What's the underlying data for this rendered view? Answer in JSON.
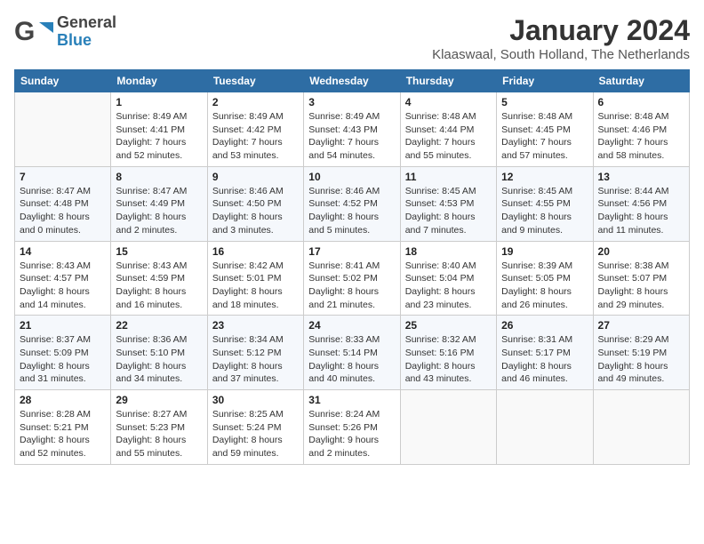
{
  "logo": {
    "text_general": "General",
    "text_blue": "Blue"
  },
  "header": {
    "month_title": "January 2024",
    "subtitle": "Klaaswaal, South Holland, The Netherlands"
  },
  "weekdays": [
    "Sunday",
    "Monday",
    "Tuesday",
    "Wednesday",
    "Thursday",
    "Friday",
    "Saturday"
  ],
  "weeks": [
    [
      {
        "day": "",
        "info": ""
      },
      {
        "day": "1",
        "info": "Sunrise: 8:49 AM\nSunset: 4:41 PM\nDaylight: 7 hours\nand 52 minutes."
      },
      {
        "day": "2",
        "info": "Sunrise: 8:49 AM\nSunset: 4:42 PM\nDaylight: 7 hours\nand 53 minutes."
      },
      {
        "day": "3",
        "info": "Sunrise: 8:49 AM\nSunset: 4:43 PM\nDaylight: 7 hours\nand 54 minutes."
      },
      {
        "day": "4",
        "info": "Sunrise: 8:48 AM\nSunset: 4:44 PM\nDaylight: 7 hours\nand 55 minutes."
      },
      {
        "day": "5",
        "info": "Sunrise: 8:48 AM\nSunset: 4:45 PM\nDaylight: 7 hours\nand 57 minutes."
      },
      {
        "day": "6",
        "info": "Sunrise: 8:48 AM\nSunset: 4:46 PM\nDaylight: 7 hours\nand 58 minutes."
      }
    ],
    [
      {
        "day": "7",
        "info": "Sunrise: 8:47 AM\nSunset: 4:48 PM\nDaylight: 8 hours\nand 0 minutes."
      },
      {
        "day": "8",
        "info": "Sunrise: 8:47 AM\nSunset: 4:49 PM\nDaylight: 8 hours\nand 2 minutes."
      },
      {
        "day": "9",
        "info": "Sunrise: 8:46 AM\nSunset: 4:50 PM\nDaylight: 8 hours\nand 3 minutes."
      },
      {
        "day": "10",
        "info": "Sunrise: 8:46 AM\nSunset: 4:52 PM\nDaylight: 8 hours\nand 5 minutes."
      },
      {
        "day": "11",
        "info": "Sunrise: 8:45 AM\nSunset: 4:53 PM\nDaylight: 8 hours\nand 7 minutes."
      },
      {
        "day": "12",
        "info": "Sunrise: 8:45 AM\nSunset: 4:55 PM\nDaylight: 8 hours\nand 9 minutes."
      },
      {
        "day": "13",
        "info": "Sunrise: 8:44 AM\nSunset: 4:56 PM\nDaylight: 8 hours\nand 11 minutes."
      }
    ],
    [
      {
        "day": "14",
        "info": "Sunrise: 8:43 AM\nSunset: 4:57 PM\nDaylight: 8 hours\nand 14 minutes."
      },
      {
        "day": "15",
        "info": "Sunrise: 8:43 AM\nSunset: 4:59 PM\nDaylight: 8 hours\nand 16 minutes."
      },
      {
        "day": "16",
        "info": "Sunrise: 8:42 AM\nSunset: 5:01 PM\nDaylight: 8 hours\nand 18 minutes."
      },
      {
        "day": "17",
        "info": "Sunrise: 8:41 AM\nSunset: 5:02 PM\nDaylight: 8 hours\nand 21 minutes."
      },
      {
        "day": "18",
        "info": "Sunrise: 8:40 AM\nSunset: 5:04 PM\nDaylight: 8 hours\nand 23 minutes."
      },
      {
        "day": "19",
        "info": "Sunrise: 8:39 AM\nSunset: 5:05 PM\nDaylight: 8 hours\nand 26 minutes."
      },
      {
        "day": "20",
        "info": "Sunrise: 8:38 AM\nSunset: 5:07 PM\nDaylight: 8 hours\nand 29 minutes."
      }
    ],
    [
      {
        "day": "21",
        "info": "Sunrise: 8:37 AM\nSunset: 5:09 PM\nDaylight: 8 hours\nand 31 minutes."
      },
      {
        "day": "22",
        "info": "Sunrise: 8:36 AM\nSunset: 5:10 PM\nDaylight: 8 hours\nand 34 minutes."
      },
      {
        "day": "23",
        "info": "Sunrise: 8:34 AM\nSunset: 5:12 PM\nDaylight: 8 hours\nand 37 minutes."
      },
      {
        "day": "24",
        "info": "Sunrise: 8:33 AM\nSunset: 5:14 PM\nDaylight: 8 hours\nand 40 minutes."
      },
      {
        "day": "25",
        "info": "Sunrise: 8:32 AM\nSunset: 5:16 PM\nDaylight: 8 hours\nand 43 minutes."
      },
      {
        "day": "26",
        "info": "Sunrise: 8:31 AM\nSunset: 5:17 PM\nDaylight: 8 hours\nand 46 minutes."
      },
      {
        "day": "27",
        "info": "Sunrise: 8:29 AM\nSunset: 5:19 PM\nDaylight: 8 hours\nand 49 minutes."
      }
    ],
    [
      {
        "day": "28",
        "info": "Sunrise: 8:28 AM\nSunset: 5:21 PM\nDaylight: 8 hours\nand 52 minutes."
      },
      {
        "day": "29",
        "info": "Sunrise: 8:27 AM\nSunset: 5:23 PM\nDaylight: 8 hours\nand 55 minutes."
      },
      {
        "day": "30",
        "info": "Sunrise: 8:25 AM\nSunset: 5:24 PM\nDaylight: 8 hours\nand 59 minutes."
      },
      {
        "day": "31",
        "info": "Sunrise: 8:24 AM\nSunset: 5:26 PM\nDaylight: 9 hours\nand 2 minutes."
      },
      {
        "day": "",
        "info": ""
      },
      {
        "day": "",
        "info": ""
      },
      {
        "day": "",
        "info": ""
      }
    ]
  ]
}
